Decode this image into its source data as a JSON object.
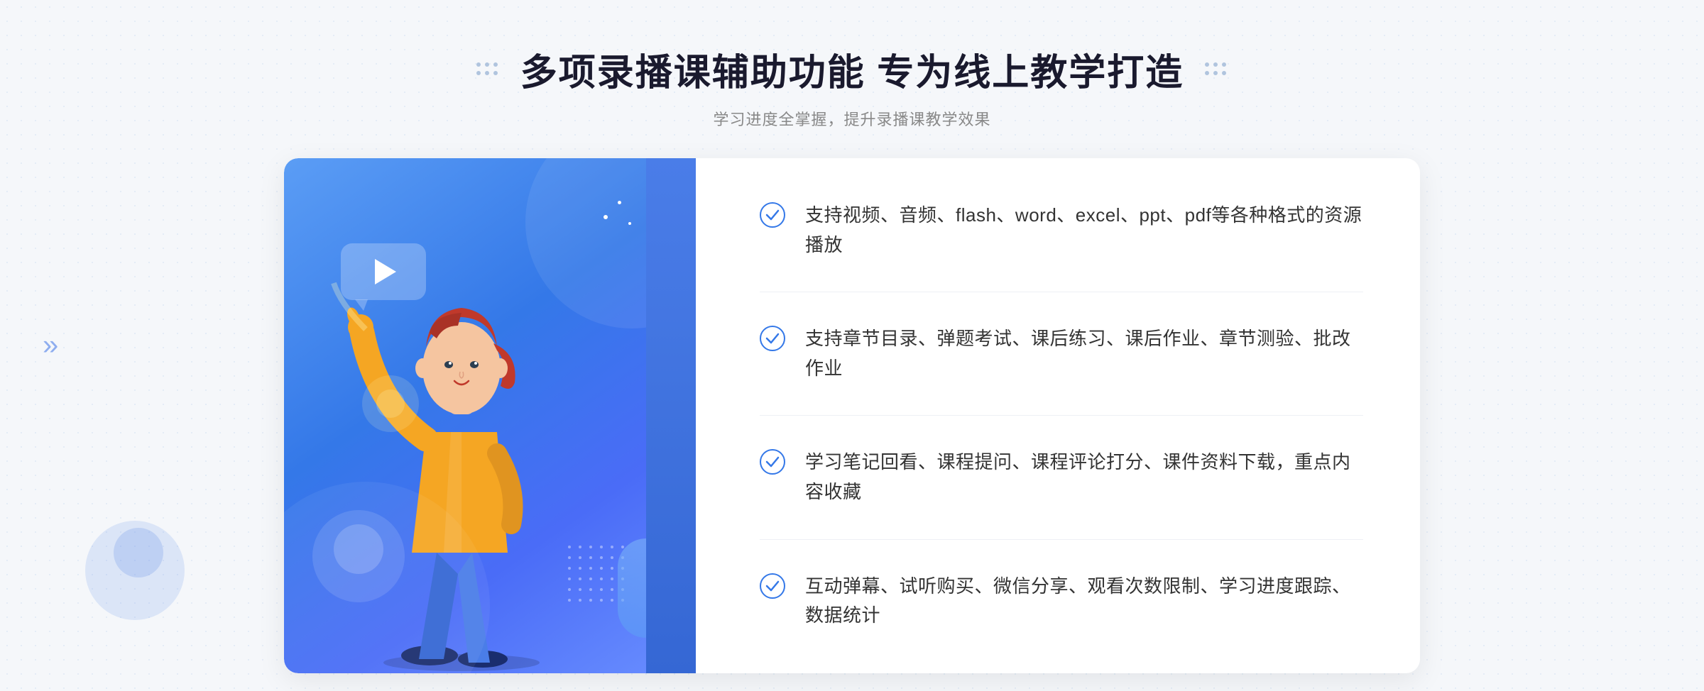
{
  "header": {
    "main_title": "多项录播课辅助功能 专为线上教学打造",
    "subtitle": "学习进度全掌握，提升录播课教学效果"
  },
  "features": [
    {
      "id": 1,
      "text": "支持视频、音频、flash、word、excel、ppt、pdf等各种格式的资源播放"
    },
    {
      "id": 2,
      "text": "支持章节目录、弹题考试、课后练习、课后作业、章节测验、批改作业"
    },
    {
      "id": 3,
      "text": "学习笔记回看、课程提问、课程评论打分、课件资料下载，重点内容收藏"
    },
    {
      "id": 4,
      "text": "互动弹幕、试听购买、微信分享、观看次数限制、学习进度跟踪、数据统计"
    }
  ],
  "colors": {
    "primary_blue": "#3478e8",
    "light_blue": "#5b9df5",
    "check_blue": "#3478e8",
    "text_dark": "#333333",
    "text_gray": "#888888"
  }
}
